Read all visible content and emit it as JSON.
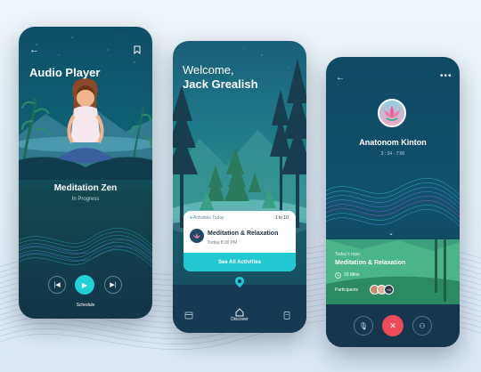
{
  "audio_player": {
    "title": "Audio Player",
    "track_title": "Meditation Zen",
    "status": "In Progress",
    "schedule_label": "Schedule"
  },
  "welcome_screen": {
    "greeting": "Welcome,",
    "user_name": "Jack Grealish",
    "activities_header": "Activities Today",
    "activities_count": "1 to 10",
    "activity_title": "Meditation & Relaxation",
    "activity_time": "Today 8:00 PM",
    "see_all_label": "See All Activities",
    "nav_discover_label": "Discover"
  },
  "session_screen": {
    "host_name": "Anatonom Kinton",
    "session_time": "3 : 34 - 7:00",
    "topic_label": "Today's topic",
    "topic_title": "Meditation & Relaxation",
    "duration": "20 Mins",
    "participants_label": "Participants",
    "participants_more": "+8"
  },
  "icons": {
    "back": "back-arrow-icon",
    "bookmark": "bookmark-icon",
    "previous": "previous-icon",
    "play": "play-icon",
    "next": "next-icon",
    "calendar": "calendar-icon",
    "home": "home-icon",
    "clipboard": "clipboard-icon",
    "location": "location-pin-icon",
    "more": "more-dots-icon",
    "chevron": "chevron-down-icon",
    "clock": "clock-icon",
    "mic": "mic-off-icon",
    "end_call": "end-call-icon",
    "add_user": "add-user-icon",
    "lotus": "lotus-icon"
  },
  "colors": {
    "accent": "#1fd0d4",
    "end_call": "#ef4a5a",
    "dark_navy": "#163a54"
  }
}
